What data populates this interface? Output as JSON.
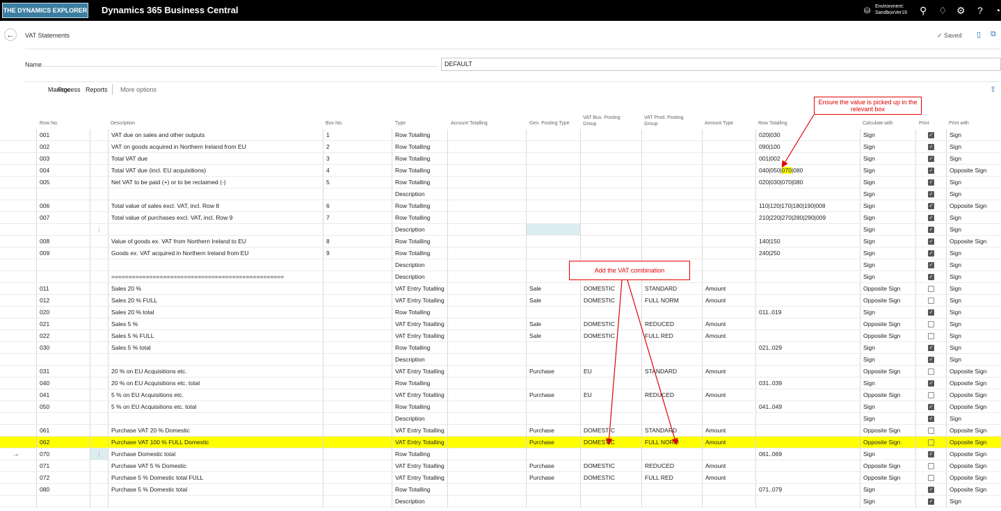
{
  "topbar": {
    "logo": "THE DYNAMICS EXPLORER",
    "app_name": "Dynamics 365 Business Central",
    "env_label": "Environment:",
    "env_name": "SandboxVer19"
  },
  "page": {
    "title": "VAT Statements",
    "saved": "Saved"
  },
  "name_field": {
    "label": "Name",
    "value": "DEFAULT"
  },
  "actions": {
    "manage": "Manage",
    "process": "Process",
    "reports": "Reports",
    "more": "More options"
  },
  "columns": {
    "row_no": "Row No.",
    "description": "Description",
    "box_no": "Box No.",
    "type": "Type",
    "account_totalling": "Account Totalling",
    "gen_posting_type": "Gen. Posting Type",
    "vat_bus_1": "VAT Bus. Posting",
    "vat_bus_2": "Group",
    "vat_prod_1": "VAT Prod. Posting",
    "vat_prod_2": "Group",
    "amount_type": "Amount Type",
    "row_totalling": "Row Totalling",
    "calculate_with": "Calculate with",
    "print": "Print",
    "print_with": "Print with"
  },
  "rows": [
    {
      "no": "001",
      "desc": "VAT due on sales and other outputs",
      "box": "1",
      "type": "Row Totalling",
      "gen": "",
      "bus": "",
      "prod": "",
      "amt": "",
      "tot": "020|030",
      "calc": "Sign",
      "print": true,
      "pw": "Sign"
    },
    {
      "no": "002",
      "desc": "VAT on goods acquired in Northern Ireland from EU",
      "box": "2",
      "type": "Row Totalling",
      "gen": "",
      "bus": "",
      "prod": "",
      "amt": "",
      "tot": "090|100",
      "calc": "Sign",
      "print": true,
      "pw": "Sign"
    },
    {
      "no": "003",
      "desc": "Total VAT due",
      "box": "3",
      "type": "Row Totalling",
      "gen": "",
      "bus": "",
      "prod": "",
      "amt": "",
      "tot": "001|002",
      "calc": "Sign",
      "print": true,
      "pw": "Sign"
    },
    {
      "no": "004",
      "desc": "Total VAT due (incl. EU acquisitions)",
      "box": "4",
      "type": "Row Totalling",
      "gen": "",
      "bus": "",
      "prod": "",
      "amt": "",
      "tot": "040|050|070|080",
      "calc": "Sign",
      "print": true,
      "pw": "Opposite Sign"
    },
    {
      "no": "005",
      "desc": "Net VAT to be paid (+) or to be reclaimed (-)",
      "box": "5",
      "type": "Row Totalling",
      "gen": "",
      "bus": "",
      "prod": "",
      "amt": "",
      "tot": "020|030|070|080",
      "calc": "Sign",
      "print": true,
      "pw": "Sign"
    },
    {
      "no": "",
      "desc": "",
      "box": "",
      "type": "Description",
      "gen": "",
      "bus": "",
      "prod": "",
      "amt": "",
      "tot": "",
      "calc": "Sign",
      "print": true,
      "pw": "Sign"
    },
    {
      "no": "006",
      "desc": "Total value of sales excl. VAT, incl. Row 8",
      "box": "6",
      "type": "Row Totalling",
      "gen": "",
      "bus": "",
      "prod": "",
      "amt": "",
      "tot": "110|120|170|180|190|008",
      "calc": "Sign",
      "print": true,
      "pw": "Opposite Sign"
    },
    {
      "no": "007",
      "desc": "Total value of purchases excl. VAT, incl. Row 9",
      "box": "7",
      "type": "Row Totalling",
      "gen": "",
      "bus": "",
      "prod": "",
      "amt": "",
      "tot": "210|220|270|280|290|009",
      "calc": "Sign",
      "print": true,
      "pw": "Sign"
    },
    {
      "no": "",
      "desc": "",
      "box": "",
      "type": "Description",
      "gen": "",
      "bus": "",
      "prod": "",
      "amt": "",
      "tot": "",
      "calc": "Sign",
      "print": true,
      "pw": "Sign"
    },
    {
      "no": "008",
      "desc": "Value of goods ex. VAT from Northern Ireland to EU",
      "box": "8",
      "type": "Row Totalling",
      "gen": "",
      "bus": "",
      "prod": "",
      "amt": "",
      "tot": "140|150",
      "calc": "Sign",
      "print": true,
      "pw": "Opposite Sign"
    },
    {
      "no": "009",
      "desc": "Goods ex. VAT acquired in Northern Ireland from EU",
      "box": "9",
      "type": "Row Totalling",
      "gen": "",
      "bus": "",
      "prod": "",
      "amt": "",
      "tot": "240|250",
      "calc": "Sign",
      "print": true,
      "pw": "Sign"
    },
    {
      "no": "",
      "desc": "",
      "box": "",
      "type": "Description",
      "gen": "",
      "bus": "",
      "prod": "",
      "amt": "",
      "tot": "",
      "calc": "Sign",
      "print": true,
      "pw": "Sign"
    },
    {
      "no": "",
      "desc": "==================================================",
      "box": "",
      "type": "Description",
      "gen": "",
      "bus": "",
      "prod": "",
      "amt": "",
      "tot": "",
      "calc": "Sign",
      "print": true,
      "pw": "Sign"
    },
    {
      "no": "011",
      "desc": "Sales 20 %",
      "box": "",
      "type": "VAT Entry Totalling",
      "gen": "Sale",
      "bus": "DOMESTIC",
      "prod": "STANDARD",
      "amt": "Amount",
      "tot": "",
      "calc": "Opposite Sign",
      "print": false,
      "pw": "Sign"
    },
    {
      "no": "012",
      "desc": "Sales 20 % FULL",
      "box": "",
      "type": "VAT Entry Totalling",
      "gen": "Sale",
      "bus": "DOMESTIC",
      "prod": "FULL NORM",
      "amt": "Amount",
      "tot": "",
      "calc": "Opposite Sign",
      "print": false,
      "pw": "Sign"
    },
    {
      "no": "020",
      "desc": "Sales 20 %  total",
      "box": "",
      "type": "Row Totalling",
      "gen": "",
      "bus": "",
      "prod": "",
      "amt": "",
      "tot": "011..019",
      "calc": "Sign",
      "print": true,
      "pw": "Sign"
    },
    {
      "no": "021",
      "desc": "Sales 5 %",
      "box": "",
      "type": "VAT Entry Totalling",
      "gen": "Sale",
      "bus": "DOMESTIC",
      "prod": "REDUCED",
      "amt": "Amount",
      "tot": "",
      "calc": "Opposite Sign",
      "print": false,
      "pw": "Sign"
    },
    {
      "no": "022",
      "desc": "Sales 5 % FULL",
      "box": "",
      "type": "VAT Entry Totalling",
      "gen": "Sale",
      "bus": "DOMESTIC",
      "prod": "FULL RED",
      "amt": "Amount",
      "tot": "",
      "calc": "Opposite Sign",
      "print": false,
      "pw": "Sign"
    },
    {
      "no": "030",
      "desc": "Sales 5 %  total",
      "box": "",
      "type": "Row Totalling",
      "gen": "",
      "bus": "",
      "prod": "",
      "amt": "",
      "tot": "021..029",
      "calc": "Sign",
      "print": true,
      "pw": "Sign"
    },
    {
      "no": "",
      "desc": "",
      "box": "",
      "type": "Description",
      "gen": "",
      "bus": "",
      "prod": "",
      "amt": "",
      "tot": "",
      "calc": "Sign",
      "print": true,
      "pw": "Sign"
    },
    {
      "no": "031",
      "desc": "20 % on EU Acquisitions etc.",
      "box": "",
      "type": "VAT Entry Totalling",
      "gen": "Purchase",
      "bus": "EU",
      "prod": "STANDARD",
      "amt": "Amount",
      "tot": "",
      "calc": "Opposite Sign",
      "print": false,
      "pw": "Opposite Sign"
    },
    {
      "no": "040",
      "desc": "20 % on EU Acquisitions etc. total",
      "box": "",
      "type": "Row Totalling",
      "gen": "",
      "bus": "",
      "prod": "",
      "amt": "",
      "tot": "031..039",
      "calc": "Sign",
      "print": true,
      "pw": "Opposite Sign"
    },
    {
      "no": "041",
      "desc": "5 % on EU Acquisitions etc.",
      "box": "",
      "type": "VAT Entry Totalling",
      "gen": "Purchase",
      "bus": "EU",
      "prod": "REDUCED",
      "amt": "Amount",
      "tot": "",
      "calc": "Opposite Sign",
      "print": false,
      "pw": "Opposite Sign"
    },
    {
      "no": "050",
      "desc": "5 % on EU Acquisitions etc. total",
      "box": "",
      "type": "Row Totalling",
      "gen": "",
      "bus": "",
      "prod": "",
      "amt": "",
      "tot": "041..049",
      "calc": "Sign",
      "print": true,
      "pw": "Opposite Sign"
    },
    {
      "no": "",
      "desc": "",
      "box": "",
      "type": "Description",
      "gen": "",
      "bus": "",
      "prod": "",
      "amt": "",
      "tot": "",
      "calc": "Sign",
      "print": true,
      "pw": "Sign"
    },
    {
      "no": "061",
      "desc": "Purchase VAT 20 % Domestic",
      "box": "",
      "type": "VAT Entry Totalling",
      "gen": "Purchase",
      "bus": "DOMESTIC",
      "prod": "STANDARD",
      "amt": "Amount",
      "tot": "",
      "calc": "Opposite Sign",
      "print": false,
      "pw": "Opposite Sign"
    },
    {
      "no": "062",
      "desc": "Purchase VAT 100 % FULL Domestic",
      "box": "",
      "type": "VAT Entry Totalling",
      "gen": "Purchase",
      "bus": "DOMESTIC",
      "prod": "FULL NORM",
      "amt": "Amount",
      "tot": "",
      "calc": "Opposite Sign",
      "print": false,
      "pw": "Opposite Sign"
    },
    {
      "no": "070",
      "desc": "Purchase Domestic total",
      "box": "",
      "type": "Row Totalling",
      "gen": "",
      "bus": "",
      "prod": "",
      "amt": "",
      "tot": "061..069",
      "calc": "Sign",
      "print": true,
      "pw": "Opposite Sign"
    },
    {
      "no": "071",
      "desc": "Purchase VAT 5 % Domestic",
      "box": "",
      "type": "VAT Entry Totalling",
      "gen": "Purchase",
      "bus": "DOMESTIC",
      "prod": "REDUCED",
      "amt": "Amount",
      "tot": "",
      "calc": "Opposite Sign",
      "print": false,
      "pw": "Opposite Sign"
    },
    {
      "no": "072",
      "desc": "Purchase 5 % Domestic total FULL",
      "box": "",
      "type": "VAT Entry Totalling",
      "gen": "Purchase",
      "bus": "DOMESTIC",
      "prod": "FULL RED",
      "amt": "Amount",
      "tot": "",
      "calc": "Opposite Sign",
      "print": false,
      "pw": "Opposite Sign"
    },
    {
      "no": "080",
      "desc": "Purchase 5 % Domestic total",
      "box": "",
      "type": "Row Totalling",
      "gen": "",
      "bus": "",
      "prod": "",
      "amt": "",
      "tot": "071..079",
      "calc": "Sign",
      "print": true,
      "pw": "Opposite Sign"
    },
    {
      "no": "",
      "desc": "",
      "box": "",
      "type": "Description",
      "gen": "",
      "bus": "",
      "prod": "",
      "amt": "",
      "tot": "",
      "calc": "Sign",
      "print": true,
      "pw": "Sign"
    }
  ],
  "annotations": {
    "box_note": "Ensure the value is picked up in the relevant box",
    "vat_note": "Add the VAT combination"
  },
  "colors": {
    "highlight": "#ffff00",
    "annotation": "#e00000",
    "accent": "#2c6fb3"
  }
}
